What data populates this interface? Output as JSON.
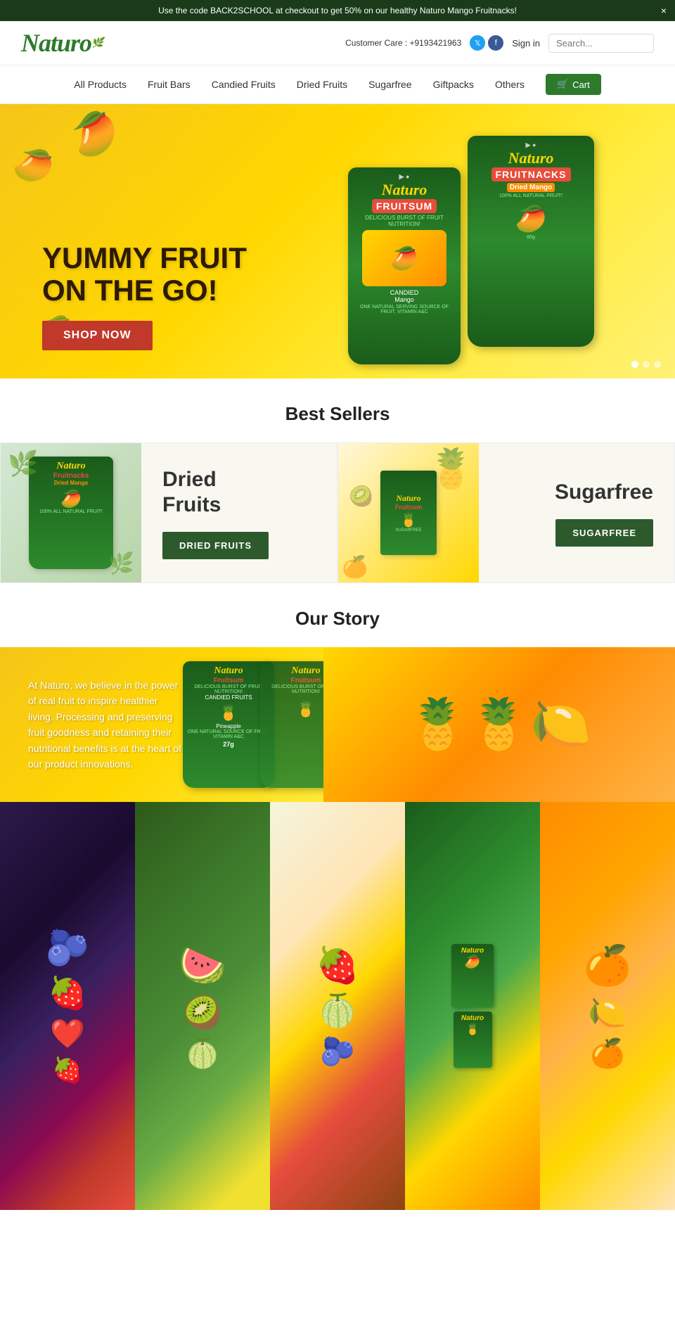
{
  "topBanner": {
    "text": "Use the code BACK2SCHOOL at checkout to get 50% on our healthy Naturo Mango Fruitnacks!",
    "closeLabel": "×"
  },
  "header": {
    "logo": "Naturo",
    "customerCare": "Customer Care : +9193421963",
    "signinLabel": "Sign in",
    "searchPlaceholder": "Search...",
    "cartLabel": "Cart",
    "socialIcons": {
      "twitter": "t",
      "facebook": "f"
    }
  },
  "nav": {
    "items": [
      {
        "label": "All Products",
        "id": "all-products"
      },
      {
        "label": "Fruit Bars",
        "id": "fruit-bars"
      },
      {
        "label": "Candied Fruits",
        "id": "candied-fruits"
      },
      {
        "label": "Dried Fruits",
        "id": "dried-fruits"
      },
      {
        "label": "Sugarfree",
        "id": "sugarfree"
      },
      {
        "label": "Giftpacks",
        "id": "giftpacks"
      },
      {
        "label": "Others",
        "id": "others"
      }
    ],
    "cartLabel": "Cart"
  },
  "hero": {
    "tagline": "YUMMY FRUIT\nON THE GO!",
    "shopNowLabel": "SHOP NOW",
    "product1Name": "Fruitsum",
    "product1Sub": "DELICIOUS BURST OF FRUIT NUTRITION!",
    "product1Type": "CANDIED Mango",
    "product2Name": "Fruitnacks",
    "product2Sub": "100% ALL NATURAL FRUIT!",
    "product2Type": "Dried Mango",
    "brandName": "Naturo"
  },
  "bestSellers": {
    "title": "Best Sellers",
    "cards": [
      {
        "title": "Dried\nFruits",
        "buttonLabel": "DRIED FRUITS",
        "id": "dried-fruits-card"
      },
      {
        "title": "Sugarfree",
        "buttonLabel": "SUGARFREE",
        "id": "sugarfree-card"
      }
    ]
  },
  "ourStory": {
    "title": "Our Story",
    "text": "At Naturo, we believe in the power of real fruit to inspire healthier living. Processing and preserving fruit goodness and retaining their nutritional benefits is at the heart of our product innovations.",
    "product1": "Fruitsum",
    "product1Sub": "CANDIED FRUITS",
    "product1Type": "Pineapple",
    "product2": "Fruitsum",
    "brandName": "Naturo"
  },
  "imageGrid": {
    "cells": [
      {
        "id": "berries-fruits",
        "emoji": "🫐🍓"
      },
      {
        "id": "tropical-fruits",
        "emoji": "🍉🥝"
      },
      {
        "id": "mixed-fruits",
        "emoji": "🍓🍈"
      },
      {
        "id": "naturo-products",
        "emoji": "🧃📦"
      },
      {
        "id": "citrus-fruits",
        "emoji": "🍊🍋"
      }
    ]
  }
}
